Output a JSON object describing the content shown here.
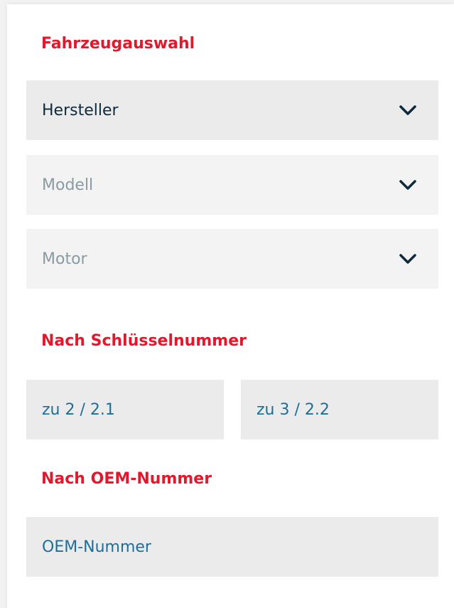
{
  "vehicle_selection": {
    "title": "Fahrzeugauswahl",
    "selects": [
      {
        "label": "Hersteller",
        "state": "enabled"
      },
      {
        "label": "Modell",
        "state": "disabled"
      },
      {
        "label": "Motor",
        "state": "disabled"
      }
    ],
    "icon": "chevron-down-icon"
  },
  "key_number": {
    "title": "Nach Schlüsselnummer",
    "field1_placeholder": "zu 2 / 2.1",
    "field2_placeholder": "zu 3 / 2.2"
  },
  "oem": {
    "title": "Nach OEM-Nummer",
    "placeholder": "OEM-Nummer"
  },
  "colors": {
    "accent": "#e3182d",
    "input_text": "#1d6e99",
    "select_text": "#0e2a3b",
    "disabled_text": "#8a9aa3",
    "field_bg": "#ebebeb"
  }
}
